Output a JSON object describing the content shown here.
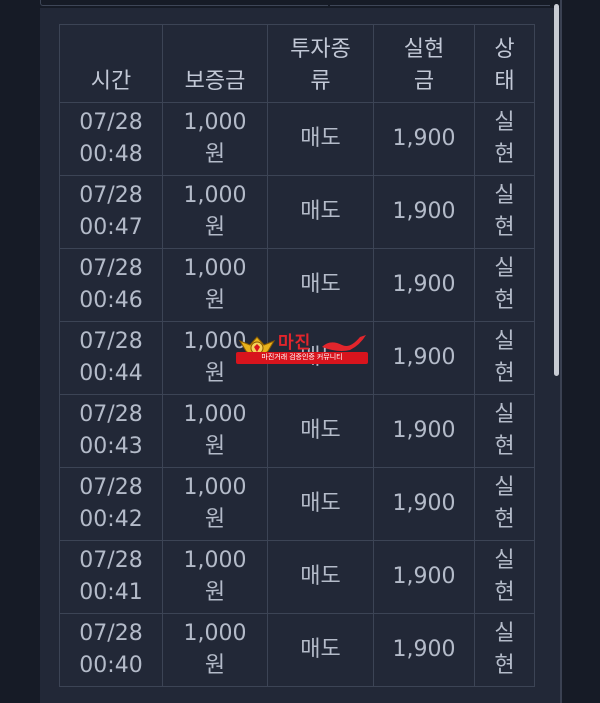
{
  "table": {
    "headers": {
      "time": [
        "시간",
        ""
      ],
      "deposit": [
        "보증금",
        ""
      ],
      "type": [
        "투자종",
        "류"
      ],
      "realized": [
        "실현",
        "금"
      ],
      "status": [
        "상",
        "태"
      ]
    },
    "rows": [
      {
        "date": "07/28",
        "time": "00:48",
        "amount": "1,000",
        "unit": "원",
        "type": "매도",
        "realized": "1,900",
        "status_1": "실",
        "status_2": "현"
      },
      {
        "date": "07/28",
        "time": "00:47",
        "amount": "1,000",
        "unit": "원",
        "type": "매도",
        "realized": "1,900",
        "status_1": "실",
        "status_2": "현"
      },
      {
        "date": "07/28",
        "time": "00:46",
        "amount": "1,000",
        "unit": "원",
        "type": "매도",
        "realized": "1,900",
        "status_1": "실",
        "status_2": "현"
      },
      {
        "date": "07/28",
        "time": "00:44",
        "amount": "1,000",
        "unit": "원",
        "type": "매도",
        "realized": "1,900",
        "status_1": "실",
        "status_2": "현"
      },
      {
        "date": "07/28",
        "time": "00:43",
        "amount": "1,000",
        "unit": "원",
        "type": "매도",
        "realized": "1,900",
        "status_1": "실",
        "status_2": "현"
      },
      {
        "date": "07/28",
        "time": "00:42",
        "amount": "1,000",
        "unit": "원",
        "type": "매도",
        "realized": "1,900",
        "status_1": "실",
        "status_2": "현"
      },
      {
        "date": "07/28",
        "time": "00:41",
        "amount": "1,000",
        "unit": "원",
        "type": "매도",
        "realized": "1,900",
        "status_1": "실",
        "status_2": "현"
      },
      {
        "date": "07/28",
        "time": "00:40",
        "amount": "1,000",
        "unit": "원",
        "type": "매도",
        "realized": "1,900",
        "status_1": "실",
        "status_2": "현"
      }
    ]
  },
  "watermark": {
    "title": "마진",
    "tagline": "마진거래 검증인증 커뮤니티"
  },
  "colors": {
    "background": "#161b26",
    "panel": "#222837",
    "border": "#3c4455",
    "text": "#b4bbc9",
    "status_green": "#4bb56a",
    "watermark_red": "#d8141d"
  }
}
